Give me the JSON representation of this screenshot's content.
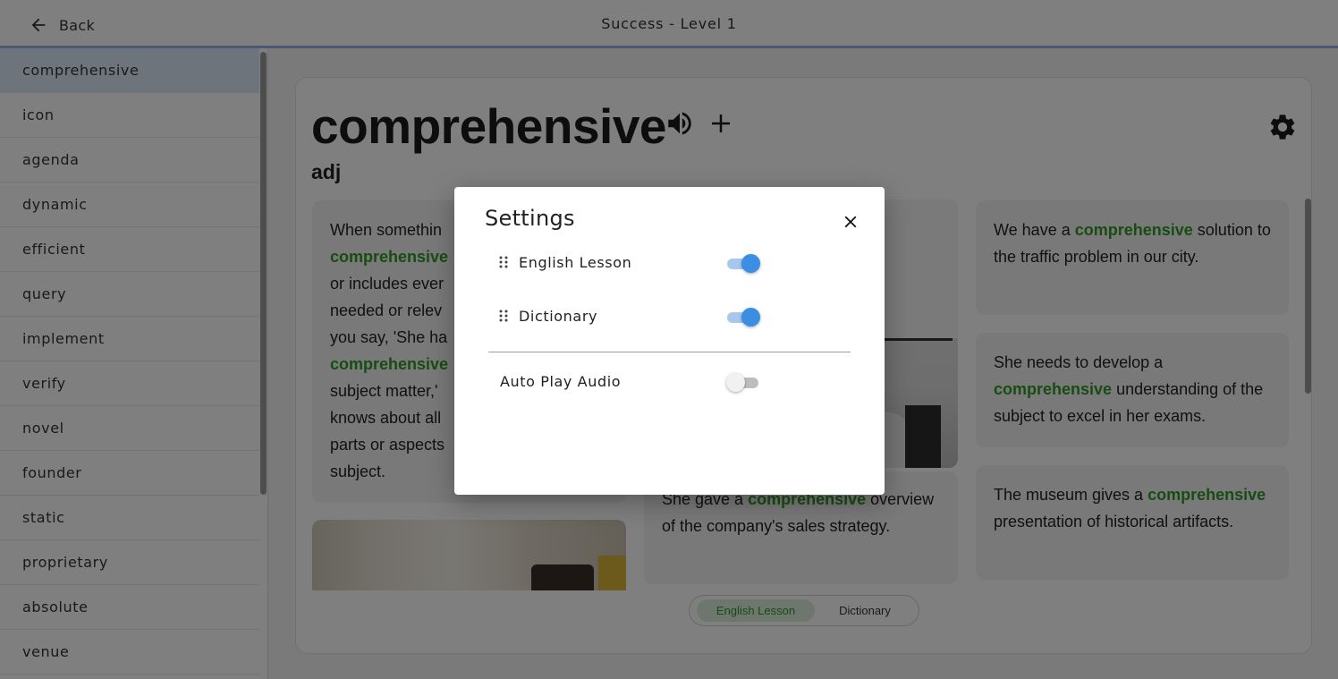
{
  "header": {
    "back_label": "Back",
    "title": "Success - Level 1"
  },
  "sidebar": {
    "items": [
      {
        "label": "comprehensive",
        "active": true
      },
      {
        "label": "icon"
      },
      {
        "label": "agenda"
      },
      {
        "label": "dynamic"
      },
      {
        "label": "efficient"
      },
      {
        "label": "query"
      },
      {
        "label": "implement"
      },
      {
        "label": "verify"
      },
      {
        "label": "novel"
      },
      {
        "label": "founder"
      },
      {
        "label": "static"
      },
      {
        "label": "proprietary"
      },
      {
        "label": "absolute"
      },
      {
        "label": "venue"
      }
    ]
  },
  "lesson": {
    "word": "comprehensive",
    "part_of_speech": "adj",
    "definition": {
      "lines": [
        "When somethin",
        "comprehensive",
        "or includes ever",
        "needed or relev",
        "you say, 'She ha",
        "comprehensive",
        "subject matter,'",
        "knows about all",
        "parts or aspects",
        "subject."
      ]
    },
    "example_middle": {
      "before": "She gave a ",
      "word": "comprehensive",
      "after": " overview of the company's sales strategy."
    },
    "examples_right": [
      {
        "before": "We have a ",
        "word": "comprehensive",
        "after": " solution to the traffic problem in our city."
      },
      {
        "before": "She needs to develop a ",
        "word": "comprehensive",
        "after": " understanding of the subject to excel in her exams."
      },
      {
        "before": "The museum gives a ",
        "word": "comprehensive",
        "after": " presentation of historical artifacts."
      }
    ],
    "tabs": {
      "active": "English Lesson",
      "inactive": "Dictionary"
    }
  },
  "colors": {
    "accent": "#3c8ee3",
    "highlight": "#2e9a25",
    "active_row": "#dce9f8"
  },
  "settings_dialog": {
    "title": "Settings",
    "rows": [
      {
        "label": "English Lesson",
        "enabled": true
      },
      {
        "label": "Dictionary",
        "enabled": true
      }
    ],
    "auto_play": {
      "label": "Auto Play Audio",
      "enabled": false
    }
  }
}
